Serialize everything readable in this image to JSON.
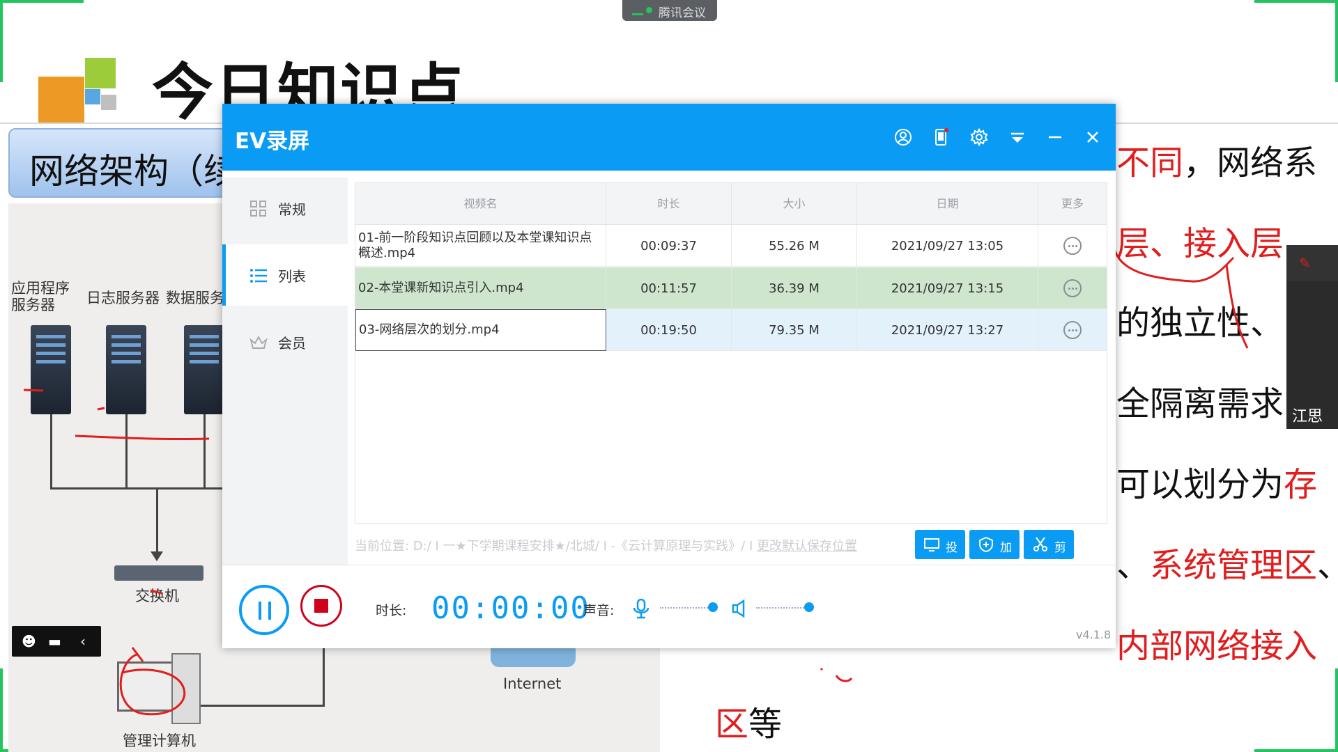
{
  "meeting": {
    "app_label": "腾讯会议",
    "participant_name": "江思"
  },
  "slide": {
    "title": "今日知识点",
    "section": "网络架构（续",
    "diagram_labels": {
      "app_server": "应用程序\n服务器",
      "log_server": "日志服务器",
      "data_server": "数据服务",
      "switch": "交换机",
      "internet": "Internet",
      "mgmt_pc": "管理计算机"
    },
    "right_text": {
      "line1_red": "不同",
      "line1_black": "，网络系",
      "line2_red": "层、接入层",
      "line3": "的独立性、",
      "line4": "全隔离需求",
      "line5_black": "可以划分为",
      "line5_red": "存",
      "line6_black1": "、",
      "line6_red": "系统管理区",
      "line6_black2": "、",
      "line7_red": "内部网络接入",
      "line8_red": "区",
      "line8_black": "等"
    }
  },
  "ev": {
    "title": "EV录屏",
    "titlebar_icons": [
      "user-icon",
      "device-icon",
      "settings-icon",
      "dropdown-icon",
      "minimize-icon",
      "close-icon"
    ],
    "nav": [
      {
        "label": "常规",
        "icon": "grid-icon"
      },
      {
        "label": "列表",
        "icon": "list-icon"
      },
      {
        "label": "会员",
        "icon": "crown-icon"
      }
    ],
    "table": {
      "headers": [
        "视频名",
        "时长",
        "大小",
        "日期",
        "更多"
      ],
      "rows": [
        {
          "name": "01-前一阶段知识点回顾以及本堂课知识点概述.mp4",
          "duration": "00:09:37",
          "size": "55.26 M",
          "date": "2021/09/27 13:05"
        },
        {
          "name": "02-本堂课新知识点引入.mp4",
          "duration": "00:11:57",
          "size": "36.39 M",
          "date": "2021/09/27 13:15"
        },
        {
          "name": "03-网络层次的划分.mp4",
          "duration": "00:19:50",
          "size": "79.35 M",
          "date": "2021/09/27 13:27"
        }
      ]
    },
    "path_label": "当前位置: D:/ I 一★下学期课程安排★/北城/ I -《云计算原理与实践》/ I",
    "change_path_link": "更改默认保存位置",
    "buttons": {
      "cast": "投屏",
      "encrypt": "加密",
      "edit": "剪辑"
    },
    "duration_label": "时长:",
    "timer": "00:00:00",
    "sound_label": "声音:",
    "mic_level": 0.95,
    "speaker_level": 0.95,
    "version": "v4.1.8",
    "accent": "#0a9cf5"
  }
}
